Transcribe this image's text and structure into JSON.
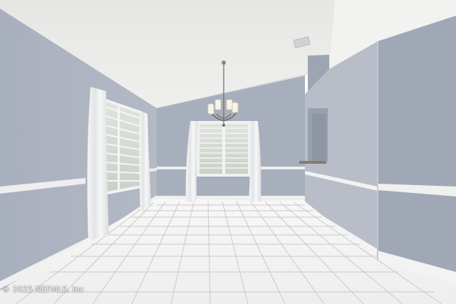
{
  "photo": {
    "subject": "empty-dining-room",
    "watermark": "© 2025 NEFMLS, Inc"
  },
  "colors": {
    "wall": "#a6adba",
    "wall_light": "#b4bac6",
    "ceiling": "#ececea",
    "trim": "#f2f2f2",
    "floor_tile": "#f3f3f2",
    "grout": "#c8c9cb"
  }
}
